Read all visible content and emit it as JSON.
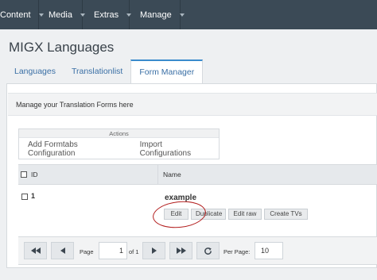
{
  "nav": {
    "items": [
      {
        "label": "Content"
      },
      {
        "label": "Media"
      },
      {
        "label": "Extras"
      },
      {
        "label": "Manage"
      }
    ]
  },
  "page": {
    "title": "MIGX Languages"
  },
  "tabs": [
    {
      "label": "Languages"
    },
    {
      "label": "Translationlist"
    },
    {
      "label": "Form Manager",
      "active": true
    }
  ],
  "panel": {
    "description": "Manage your Translation Forms here"
  },
  "actions": {
    "title": "Actions",
    "buttons": [
      {
        "label": "Add Formtabs Configuration"
      },
      {
        "label": "Import Configurations"
      }
    ]
  },
  "grid": {
    "columns": [
      "ID",
      "Name"
    ],
    "rows": [
      {
        "id": "1",
        "name": "example",
        "buttons": [
          "Edit",
          "Duplicate",
          "Edit raw",
          "Create TVs"
        ]
      }
    ]
  },
  "pager": {
    "page_label": "Page",
    "page_value": "1",
    "of_label": "of 1",
    "per_page_label": "Per Page:",
    "per_page_value": "10"
  },
  "annotation": {
    "color": "#b31e1e"
  }
}
